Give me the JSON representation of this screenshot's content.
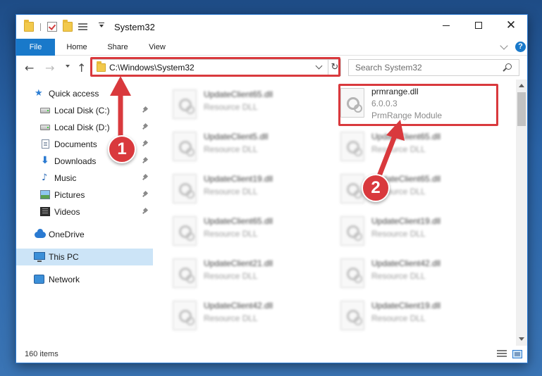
{
  "window": {
    "title": "System32"
  },
  "ribbon": {
    "tabs": [
      {
        "label": "File"
      },
      {
        "label": "Home"
      },
      {
        "label": "Share"
      },
      {
        "label": "View"
      }
    ],
    "help_label": "?"
  },
  "nav": {
    "address": "C:\\Windows\\System32",
    "search_placeholder": "Search System32"
  },
  "sidebar": {
    "items": [
      {
        "label": "Quick access"
      },
      {
        "label": "Local Disk (C:)"
      },
      {
        "label": "Local Disk (D:)"
      },
      {
        "label": "Documents"
      },
      {
        "label": "Downloads"
      },
      {
        "label": "Music"
      },
      {
        "label": "Pictures"
      },
      {
        "label": "Videos"
      },
      {
        "label": "OneDrive"
      },
      {
        "label": "This PC"
      },
      {
        "label": "Network"
      }
    ]
  },
  "files": [
    {
      "name": "UpdateClient65.dll",
      "type": "Resource DLL"
    },
    {
      "name": "prmrange.dll",
      "version": "6.0.0.3",
      "type": "PrmRange Module"
    },
    {
      "name": "UpdateClient5.dll",
      "type": "Resource DLL"
    },
    {
      "name": "UpdateClient65.dll",
      "type": "Resource DLL"
    },
    {
      "name": "UpdateClient19.dll",
      "type": "Resource DLL"
    },
    {
      "name": "UpdateClient65.dll",
      "type": "Resource DLL"
    },
    {
      "name": "UpdateClient65.dll",
      "type": "Resource DLL"
    },
    {
      "name": "UpdateClient19.dll",
      "type": "Resource DLL"
    },
    {
      "name": "UpdateClient21.dll",
      "type": "Resource DLL"
    },
    {
      "name": "UpdateClient42.dll",
      "type": "Resource DLL"
    },
    {
      "name": "UpdateClient42.dll",
      "type": "Resource DLL"
    },
    {
      "name": "UpdateClient19.dll",
      "type": "Resource DLL"
    }
  ],
  "status": {
    "item_count": "160 items"
  },
  "annotations": {
    "step1": "1",
    "step2": "2",
    "color": "#d9393d"
  }
}
